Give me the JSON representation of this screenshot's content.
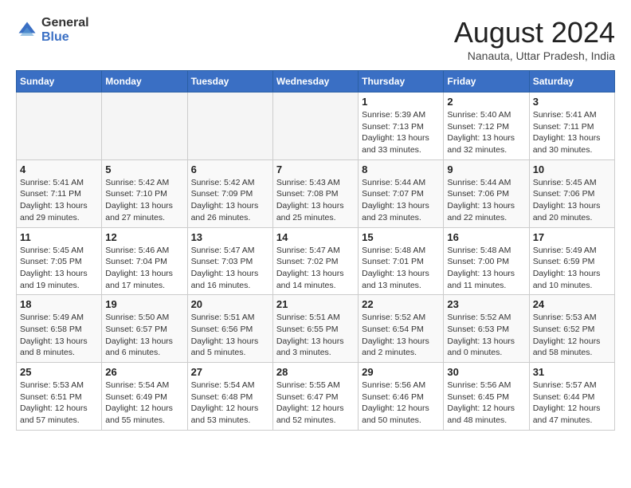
{
  "logo": {
    "general": "General",
    "blue": "Blue"
  },
  "title": "August 2024",
  "location": "Nanauta, Uttar Pradesh, India",
  "days_of_week": [
    "Sunday",
    "Monday",
    "Tuesday",
    "Wednesday",
    "Thursday",
    "Friday",
    "Saturday"
  ],
  "weeks": [
    [
      {
        "num": "",
        "info": "",
        "empty": true
      },
      {
        "num": "",
        "info": "",
        "empty": true
      },
      {
        "num": "",
        "info": "",
        "empty": true
      },
      {
        "num": "",
        "info": "",
        "empty": true
      },
      {
        "num": "1",
        "info": "Sunrise: 5:39 AM\nSunset: 7:13 PM\nDaylight: 13 hours\nand 33 minutes.",
        "empty": false
      },
      {
        "num": "2",
        "info": "Sunrise: 5:40 AM\nSunset: 7:12 PM\nDaylight: 13 hours\nand 32 minutes.",
        "empty": false
      },
      {
        "num": "3",
        "info": "Sunrise: 5:41 AM\nSunset: 7:11 PM\nDaylight: 13 hours\nand 30 minutes.",
        "empty": false
      }
    ],
    [
      {
        "num": "4",
        "info": "Sunrise: 5:41 AM\nSunset: 7:11 PM\nDaylight: 13 hours\nand 29 minutes.",
        "empty": false
      },
      {
        "num": "5",
        "info": "Sunrise: 5:42 AM\nSunset: 7:10 PM\nDaylight: 13 hours\nand 27 minutes.",
        "empty": false
      },
      {
        "num": "6",
        "info": "Sunrise: 5:42 AM\nSunset: 7:09 PM\nDaylight: 13 hours\nand 26 minutes.",
        "empty": false
      },
      {
        "num": "7",
        "info": "Sunrise: 5:43 AM\nSunset: 7:08 PM\nDaylight: 13 hours\nand 25 minutes.",
        "empty": false
      },
      {
        "num": "8",
        "info": "Sunrise: 5:44 AM\nSunset: 7:07 PM\nDaylight: 13 hours\nand 23 minutes.",
        "empty": false
      },
      {
        "num": "9",
        "info": "Sunrise: 5:44 AM\nSunset: 7:06 PM\nDaylight: 13 hours\nand 22 minutes.",
        "empty": false
      },
      {
        "num": "10",
        "info": "Sunrise: 5:45 AM\nSunset: 7:06 PM\nDaylight: 13 hours\nand 20 minutes.",
        "empty": false
      }
    ],
    [
      {
        "num": "11",
        "info": "Sunrise: 5:45 AM\nSunset: 7:05 PM\nDaylight: 13 hours\nand 19 minutes.",
        "empty": false
      },
      {
        "num": "12",
        "info": "Sunrise: 5:46 AM\nSunset: 7:04 PM\nDaylight: 13 hours\nand 17 minutes.",
        "empty": false
      },
      {
        "num": "13",
        "info": "Sunrise: 5:47 AM\nSunset: 7:03 PM\nDaylight: 13 hours\nand 16 minutes.",
        "empty": false
      },
      {
        "num": "14",
        "info": "Sunrise: 5:47 AM\nSunset: 7:02 PM\nDaylight: 13 hours\nand 14 minutes.",
        "empty": false
      },
      {
        "num": "15",
        "info": "Sunrise: 5:48 AM\nSunset: 7:01 PM\nDaylight: 13 hours\nand 13 minutes.",
        "empty": false
      },
      {
        "num": "16",
        "info": "Sunrise: 5:48 AM\nSunset: 7:00 PM\nDaylight: 13 hours\nand 11 minutes.",
        "empty": false
      },
      {
        "num": "17",
        "info": "Sunrise: 5:49 AM\nSunset: 6:59 PM\nDaylight: 13 hours\nand 10 minutes.",
        "empty": false
      }
    ],
    [
      {
        "num": "18",
        "info": "Sunrise: 5:49 AM\nSunset: 6:58 PM\nDaylight: 13 hours\nand 8 minutes.",
        "empty": false
      },
      {
        "num": "19",
        "info": "Sunrise: 5:50 AM\nSunset: 6:57 PM\nDaylight: 13 hours\nand 6 minutes.",
        "empty": false
      },
      {
        "num": "20",
        "info": "Sunrise: 5:51 AM\nSunset: 6:56 PM\nDaylight: 13 hours\nand 5 minutes.",
        "empty": false
      },
      {
        "num": "21",
        "info": "Sunrise: 5:51 AM\nSunset: 6:55 PM\nDaylight: 13 hours\nand 3 minutes.",
        "empty": false
      },
      {
        "num": "22",
        "info": "Sunrise: 5:52 AM\nSunset: 6:54 PM\nDaylight: 13 hours\nand 2 minutes.",
        "empty": false
      },
      {
        "num": "23",
        "info": "Sunrise: 5:52 AM\nSunset: 6:53 PM\nDaylight: 13 hours\nand 0 minutes.",
        "empty": false
      },
      {
        "num": "24",
        "info": "Sunrise: 5:53 AM\nSunset: 6:52 PM\nDaylight: 12 hours\nand 58 minutes.",
        "empty": false
      }
    ],
    [
      {
        "num": "25",
        "info": "Sunrise: 5:53 AM\nSunset: 6:51 PM\nDaylight: 12 hours\nand 57 minutes.",
        "empty": false
      },
      {
        "num": "26",
        "info": "Sunrise: 5:54 AM\nSunset: 6:49 PM\nDaylight: 12 hours\nand 55 minutes.",
        "empty": false
      },
      {
        "num": "27",
        "info": "Sunrise: 5:54 AM\nSunset: 6:48 PM\nDaylight: 12 hours\nand 53 minutes.",
        "empty": false
      },
      {
        "num": "28",
        "info": "Sunrise: 5:55 AM\nSunset: 6:47 PM\nDaylight: 12 hours\nand 52 minutes.",
        "empty": false
      },
      {
        "num": "29",
        "info": "Sunrise: 5:56 AM\nSunset: 6:46 PM\nDaylight: 12 hours\nand 50 minutes.",
        "empty": false
      },
      {
        "num": "30",
        "info": "Sunrise: 5:56 AM\nSunset: 6:45 PM\nDaylight: 12 hours\nand 48 minutes.",
        "empty": false
      },
      {
        "num": "31",
        "info": "Sunrise: 5:57 AM\nSunset: 6:44 PM\nDaylight: 12 hours\nand 47 minutes.",
        "empty": false
      }
    ]
  ]
}
